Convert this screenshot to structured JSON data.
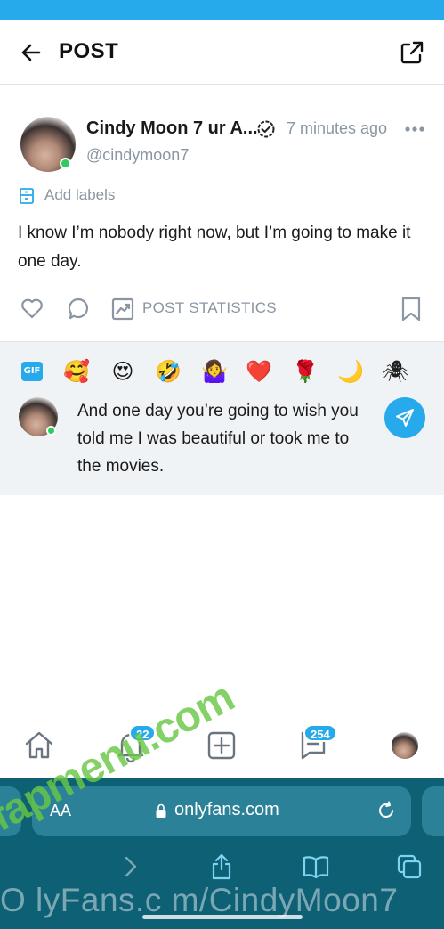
{
  "header": {
    "title": "POST"
  },
  "post": {
    "author_name": "Cindy Moon 7 ur A...",
    "time": "7 minutes ago",
    "handle": "@cindymoon7",
    "labels_text": "Add labels",
    "text": "I know I’m nobody right now, but I’m going to make it one day.",
    "stats_label": "POST STATISTICS"
  },
  "composer": {
    "gif_label": "GIF",
    "emojis": [
      "🥰",
      "😍",
      "🤣",
      "🤷‍♀️",
      "❤️",
      "🌹",
      "🌙",
      "🕷"
    ],
    "comment_text": "And one day you’re going to wish you told me I was beautiful or took me to the movies."
  },
  "bottom_nav": {
    "notifications_count": "22",
    "messages_count": "254"
  },
  "browser": {
    "aa_label": "AA",
    "url": "onlyfans.com"
  },
  "watermark": {
    "url_text": "O lyFans.c m/CindyMoon7",
    "logo_text": "fapmenu.com"
  },
  "colors": {
    "accent": "#27aaeb",
    "online": "#2ecb5d",
    "muted_text": "#8a96a3",
    "browser_bg": "#0e6075"
  },
  "icons": [
    "back-arrow-icon",
    "share-icon",
    "verified-icon",
    "more-dots-icon",
    "label-icon",
    "heart-icon",
    "comment-icon",
    "stats-icon",
    "bookmark-icon",
    "send-icon",
    "home-icon",
    "bell-icon",
    "add-post-icon",
    "messages-icon",
    "lock-icon",
    "reload-icon",
    "browser-forward-icon",
    "browser-share-icon",
    "bookmarks-book-icon",
    "tabs-icon"
  ]
}
